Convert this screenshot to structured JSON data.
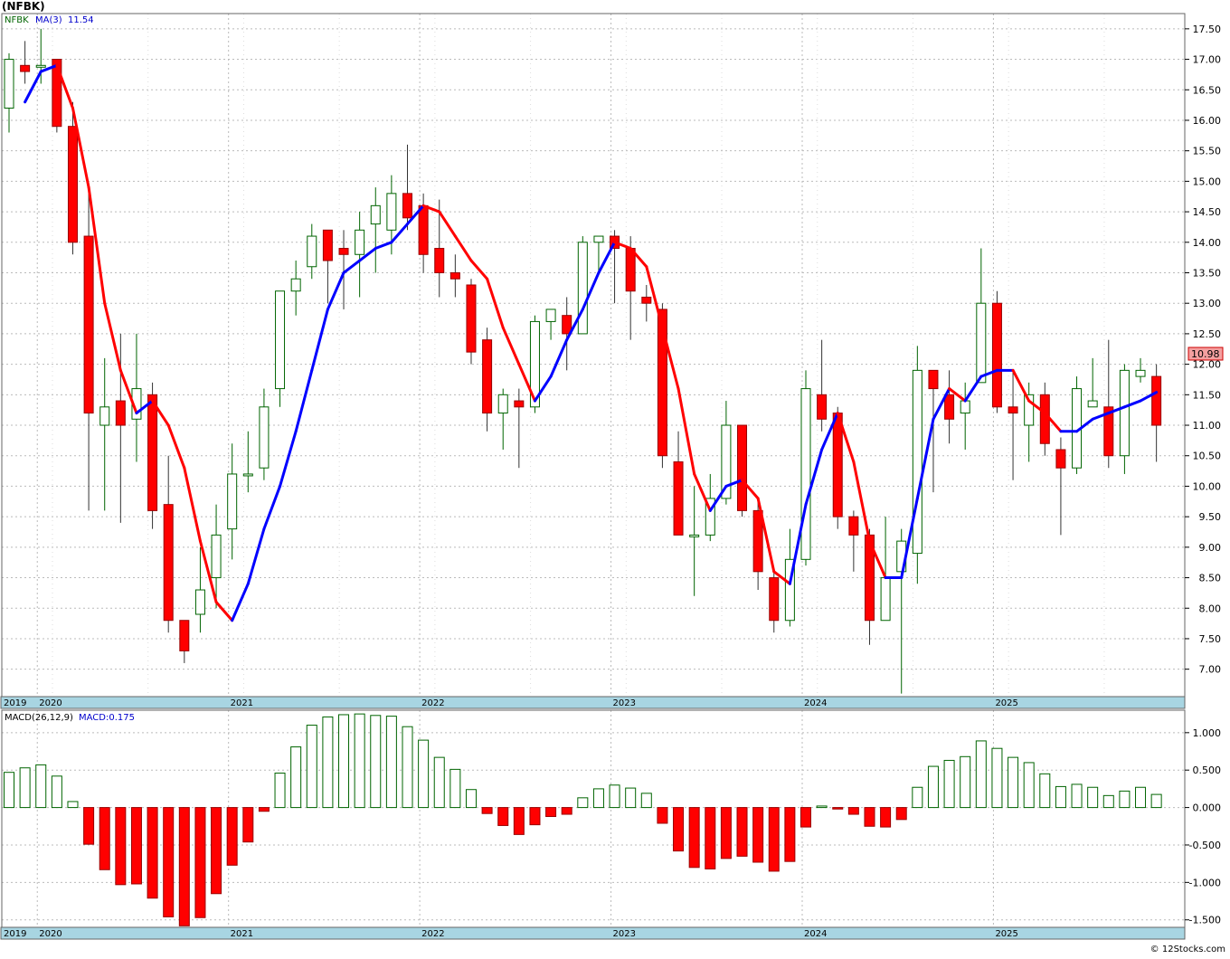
{
  "header": {
    "title": "(NFBK)"
  },
  "price_legend": {
    "symbol": "NFBK",
    "ma_label": "MA(3)",
    "ma_value": "11.54"
  },
  "macd_legend": {
    "label": "MACD(26,12,9)",
    "value": "MACD:0.175"
  },
  "last_price_tag": "10.98",
  "footer": {
    "copyright": "© 12Stocks.com"
  },
  "colors": {
    "up_candle": "#006400",
    "down_candle": "#ff0000",
    "ma_rising": "#0000ff",
    "ma_falling": "#ff0000",
    "timeline_band": "#a8d5e2",
    "grid": "#bbbbbb"
  },
  "chart_data": [
    {
      "type": "candlestick",
      "name": "price",
      "period": "monthly",
      "ylim": [
        6.55,
        17.75
      ],
      "y_ticks": [
        "17.50",
        "17.00",
        "16.50",
        "16.00",
        "15.50",
        "15.00",
        "14.50",
        "14.00",
        "13.50",
        "13.00",
        "12.50",
        "12.00",
        "11.50",
        "11.00",
        "10.50",
        "10.00",
        "9.50",
        "9.00",
        "8.50",
        "8.00",
        "7.50",
        "7.00"
      ],
      "x_labels": [
        "2019",
        "2020",
        "2021",
        "2022",
        "2023",
        "2024",
        "2025"
      ],
      "ohlc": [
        [
          16.2,
          17.1,
          15.8,
          17.0
        ],
        [
          16.9,
          17.3,
          16.6,
          16.8
        ],
        [
          16.9,
          17.5,
          16.6,
          16.9
        ],
        [
          17.0,
          17.0,
          15.8,
          15.9
        ],
        [
          15.9,
          16.3,
          13.8,
          14.0
        ],
        [
          14.1,
          14.8,
          9.6,
          11.2
        ],
        [
          11.0,
          12.1,
          9.6,
          11.3
        ],
        [
          11.4,
          12.5,
          9.4,
          11.0
        ],
        [
          11.1,
          12.5,
          10.4,
          11.6
        ],
        [
          11.5,
          11.7,
          9.3,
          9.6
        ],
        [
          9.7,
          10.5,
          7.6,
          7.8
        ],
        [
          7.8,
          7.8,
          7.1,
          7.3
        ],
        [
          7.9,
          9.0,
          7.6,
          8.3
        ],
        [
          8.5,
          9.7,
          8.0,
          9.2
        ],
        [
          9.3,
          10.7,
          8.8,
          10.2
        ],
        [
          10.2,
          10.9,
          9.9,
          10.2
        ],
        [
          10.3,
          11.6,
          10.1,
          11.3
        ],
        [
          11.6,
          12.8,
          11.3,
          13.2
        ],
        [
          13.2,
          13.7,
          12.8,
          13.4
        ],
        [
          13.6,
          14.3,
          13.4,
          14.1
        ],
        [
          14.2,
          14.1,
          13.0,
          13.7
        ],
        [
          13.9,
          14.2,
          12.9,
          13.8
        ],
        [
          13.8,
          14.5,
          13.1,
          14.2
        ],
        [
          14.3,
          14.9,
          13.5,
          14.6
        ],
        [
          14.2,
          15.1,
          13.8,
          14.8
        ],
        [
          14.8,
          15.6,
          14.2,
          14.4
        ],
        [
          14.6,
          14.8,
          13.5,
          13.8
        ],
        [
          13.9,
          14.7,
          13.1,
          13.5
        ],
        [
          13.5,
          13.8,
          13.1,
          13.4
        ],
        [
          13.3,
          13.4,
          12.0,
          12.2
        ],
        [
          12.4,
          12.6,
          10.9,
          11.2
        ],
        [
          11.2,
          11.6,
          10.6,
          11.5
        ],
        [
          11.4,
          11.6,
          10.3,
          11.3
        ],
        [
          11.3,
          12.8,
          11.2,
          12.7
        ],
        [
          12.7,
          12.8,
          12.4,
          12.9
        ],
        [
          12.8,
          13.1,
          11.9,
          12.5
        ],
        [
          12.5,
          14.1,
          12.5,
          14.0
        ],
        [
          14.0,
          14.0,
          13.5,
          14.1
        ],
        [
          14.1,
          14.2,
          13.0,
          13.9
        ],
        [
          13.9,
          14.1,
          12.4,
          13.2
        ],
        [
          13.1,
          13.3,
          12.7,
          13.0
        ],
        [
          12.9,
          13.0,
          10.3,
          10.5
        ],
        [
          10.4,
          10.9,
          9.2,
          9.2
        ],
        [
          9.2,
          10.0,
          8.2,
          9.2
        ],
        [
          9.2,
          10.2,
          9.1,
          9.8
        ],
        [
          9.8,
          11.4,
          9.7,
          11.0
        ],
        [
          11.0,
          10.9,
          9.5,
          9.6
        ],
        [
          9.6,
          9.8,
          8.3,
          8.6
        ],
        [
          8.5,
          8.6,
          7.6,
          7.8
        ],
        [
          7.8,
          9.3,
          7.7,
          8.8
        ],
        [
          8.8,
          11.9,
          8.7,
          11.6
        ],
        [
          11.5,
          12.4,
          10.9,
          11.1
        ],
        [
          11.2,
          11.3,
          9.3,
          9.5
        ],
        [
          9.5,
          9.6,
          8.6,
          9.2
        ],
        [
          9.2,
          9.3,
          7.4,
          7.8
        ],
        [
          7.8,
          9.5,
          7.8,
          8.5
        ],
        [
          8.6,
          9.3,
          6.6,
          9.1
        ],
        [
          8.9,
          12.3,
          8.4,
          11.9
        ],
        [
          11.9,
          11.9,
          9.9,
          11.6
        ],
        [
          11.5,
          11.9,
          10.7,
          11.1
        ],
        [
          11.2,
          11.7,
          10.6,
          11.4
        ],
        [
          11.7,
          13.9,
          11.7,
          13.0
        ],
        [
          13.0,
          13.2,
          11.2,
          11.3
        ],
        [
          11.3,
          11.9,
          10.1,
          11.2
        ],
        [
          11.0,
          11.7,
          10.4,
          11.5
        ],
        [
          11.5,
          11.7,
          10.5,
          10.7
        ],
        [
          10.6,
          10.8,
          9.2,
          10.3
        ],
        [
          10.3,
          11.8,
          10.2,
          11.6
        ],
        [
          11.3,
          12.1,
          11.3,
          11.4
        ],
        [
          11.3,
          12.4,
          10.3,
          10.5
        ],
        [
          10.5,
          12.0,
          10.2,
          11.9
        ],
        [
          11.8,
          12.1,
          11.7,
          11.9
        ],
        [
          11.8,
          12.0,
          10.4,
          11.0
        ]
      ],
      "ma3": [
        null,
        16.3,
        16.8,
        16.9,
        16.2,
        14.9,
        13.0,
        11.9,
        11.2,
        11.4,
        11.0,
        10.3,
        9.1,
        8.1,
        7.8,
        8.4,
        9.3,
        10.0,
        10.9,
        11.9,
        12.9,
        13.5,
        13.7,
        13.9,
        14.0,
        14.3,
        14.6,
        14.5,
        14.1,
        13.7,
        13.4,
        12.6,
        12.0,
        11.4,
        11.8,
        12.4,
        12.9,
        13.5,
        14.0,
        13.9,
        13.6,
        12.6,
        11.6,
        10.2,
        9.6,
        10.0,
        10.1,
        9.8,
        8.6,
        8.4,
        9.7,
        10.6,
        11.2,
        10.4,
        9.1,
        8.5,
        8.5,
        9.8,
        11.1,
        11.6,
        11.4,
        11.8,
        11.9,
        11.9,
        11.4,
        11.2,
        10.9,
        10.9,
        11.1,
        11.2,
        11.3,
        11.4,
        11.54
      ]
    },
    {
      "type": "bar",
      "name": "MACD(26,12,9)",
      "ylim": [
        -1.6,
        1.3
      ],
      "y_ticks": [
        "1.000",
        "0.500",
        "0.000",
        "-0.500",
        "-1.000",
        "-1.500"
      ],
      "x_labels": [
        "2019",
        "2020",
        "2021",
        "2022",
        "2023",
        "2024",
        "2025"
      ],
      "values": [
        0.47,
        0.53,
        0.57,
        0.42,
        0.08,
        -0.49,
        -0.83,
        -1.03,
        -1.02,
        -1.21,
        -1.46,
        -1.58,
        -1.47,
        -1.15,
        -0.77,
        -0.46,
        -0.05,
        0.46,
        0.81,
        1.1,
        1.21,
        1.24,
        1.25,
        1.23,
        1.22,
        1.08,
        0.9,
        0.67,
        0.51,
        0.24,
        -0.08,
        -0.24,
        -0.36,
        -0.23,
        -0.12,
        -0.09,
        0.13,
        0.25,
        0.3,
        0.26,
        0.19,
        -0.21,
        -0.58,
        -0.8,
        -0.82,
        -0.68,
        -0.65,
        -0.73,
        -0.85,
        -0.72,
        -0.26,
        0.02,
        -0.02,
        -0.09,
        -0.25,
        -0.26,
        -0.16,
        0.27,
        0.55,
        0.63,
        0.68,
        0.89,
        0.79,
        0.67,
        0.6,
        0.45,
        0.28,
        0.31,
        0.27,
        0.16,
        0.22,
        0.27,
        0.175
      ]
    }
  ]
}
